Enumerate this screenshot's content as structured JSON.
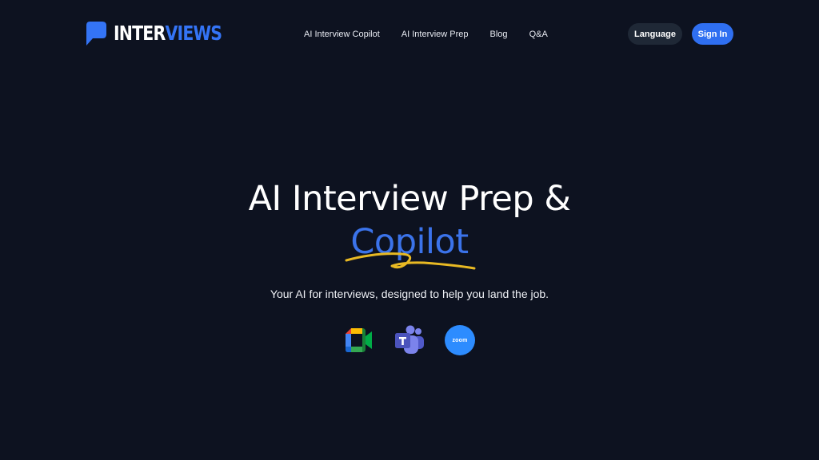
{
  "brand": {
    "name_part1": "INTER",
    "name_part2": "VIEWS",
    "logo_icon": "speech-bubble-icon",
    "primary_color": "#3474f5",
    "background_color": "#0d1220"
  },
  "nav": {
    "items": [
      {
        "label": "AI Interview Copilot"
      },
      {
        "label": "AI Interview Prep"
      },
      {
        "label": "Blog"
      },
      {
        "label": "Q&A"
      }
    ]
  },
  "header_actions": {
    "language_label": "Language",
    "signin_label": "Sign In"
  },
  "hero": {
    "title_line1": "AI Interview Prep &",
    "title_line2": "Copilot",
    "underline_color": "#e8b923",
    "subtitle": "Your AI for interviews, designed to help you land the job."
  },
  "platforms": [
    {
      "icon": "google-meet-icon"
    },
    {
      "icon": "microsoft-teams-icon"
    },
    {
      "icon": "zoom-icon",
      "label": "zoom"
    }
  ]
}
